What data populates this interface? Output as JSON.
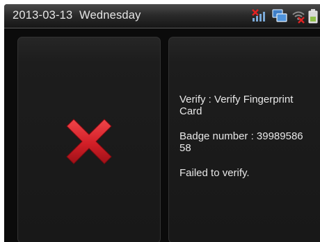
{
  "status_bar": {
    "date": "2013-03-13",
    "weekday": "Wednesday",
    "icons": [
      "signal-off-icon",
      "network-icon",
      "wifi-off-icon",
      "battery-icon"
    ]
  },
  "result": {
    "icon": "red-x-icon",
    "icon_color": "#d7262c",
    "verify_line1": "Verify : Verify Fingerprint",
    "verify_line2": "Card",
    "badge_line1": "Badge number : 39989586",
    "badge_line2": "58",
    "message": "Failed to verify."
  }
}
